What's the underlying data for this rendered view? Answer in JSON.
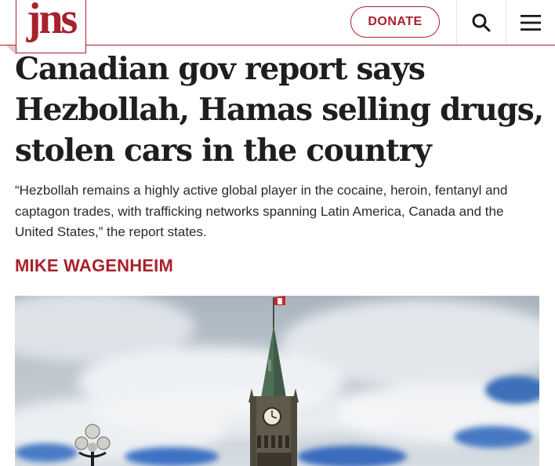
{
  "header": {
    "logo_text": "jns",
    "donate_label": "DONATE",
    "search_icon": "search-icon",
    "menu_icon": "hamburger-menu-icon",
    "brand_color": "#a8212d"
  },
  "article": {
    "headline_line1": "Canadian gov report says",
    "headline_line2": "Hezbollah, Hamas selling drugs,",
    "headline_line3": "stolen cars in the country",
    "dek_line1": "“Hezbollah remains a highly active global player in the cocaine, heroin, fentanyl and",
    "dek_line2": "captagon trades, with trafficking networks spanning Latin America, Canada and the",
    "dek_line3": "United States,” the report states.",
    "author": "MIKE WAGENHEIM"
  }
}
